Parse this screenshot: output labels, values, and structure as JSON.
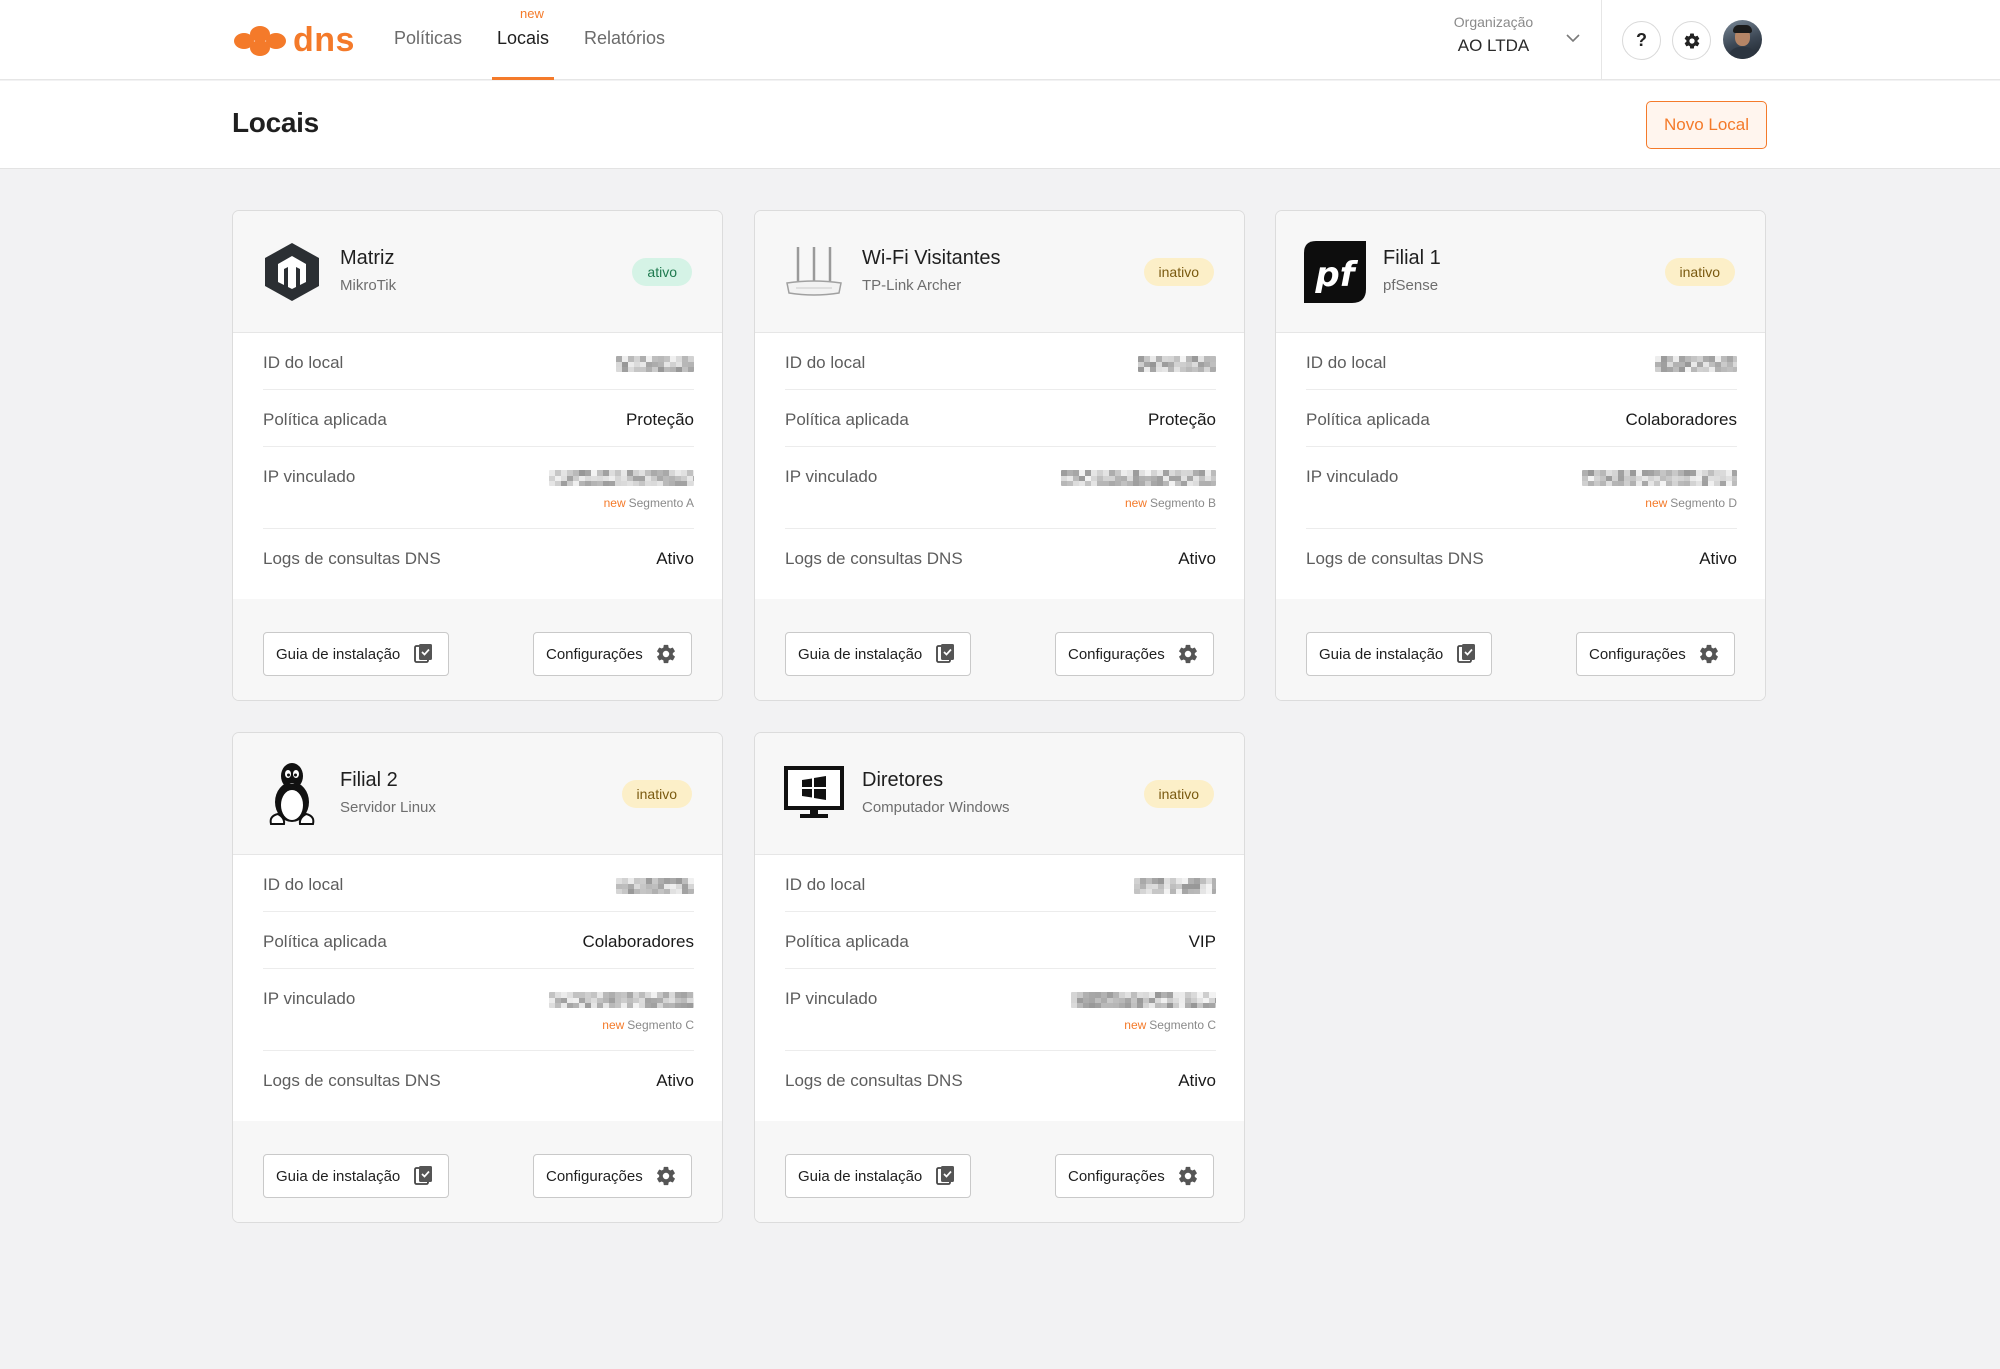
{
  "nav": {
    "logo_text": "dns",
    "links": [
      {
        "label": "Políticas"
      },
      {
        "label": "Locais",
        "badge": "new"
      },
      {
        "label": "Relatórios"
      }
    ]
  },
  "org": {
    "label": "Organização",
    "name": "AO LTDA"
  },
  "header_icons": {
    "help": "?"
  },
  "page": {
    "title": "Locais",
    "new_button": "Novo Local"
  },
  "labels": {
    "id": "ID do local",
    "policy": "Política aplicada",
    "ip": "IP vinculado",
    "logs": "Logs de consultas DNS",
    "segment_new": "new",
    "guide_button": "Guia de instalação",
    "config_button": "Configurações"
  },
  "locations": [
    {
      "name": "Matriz",
      "device": "MikroTik",
      "status": "ativo",
      "policy": "Proteção",
      "segment": "Segmento A",
      "logs": "Ativo",
      "icon": "mikrotik-icon"
    },
    {
      "name": "Wi-Fi Visitantes",
      "device": "TP-Link Archer",
      "status": "inativo",
      "policy": "Proteção",
      "segment": "Segmento B",
      "logs": "Ativo",
      "icon": "router-icon"
    },
    {
      "name": "Filial 1",
      "device": "pfSense",
      "status": "inativo",
      "policy": "Colaboradores",
      "segment": "Segmento D",
      "logs": "Ativo",
      "icon": "pfsense-icon"
    },
    {
      "name": "Filial 2",
      "device": "Servidor Linux",
      "status": "inativo",
      "policy": "Colaboradores",
      "segment": "Segmento C",
      "logs": "Ativo",
      "icon": "linux-tux-icon"
    },
    {
      "name": "Diretores",
      "device": "Computador Windows",
      "status": "inativo",
      "policy": "VIP",
      "segment": "Segmento C",
      "logs": "Ativo",
      "icon": "windows-monitor-icon"
    }
  ],
  "colors": {
    "accent": "#f47a2a",
    "active_badge": "#d5f3e6",
    "inactive_badge": "#fcefc8"
  }
}
